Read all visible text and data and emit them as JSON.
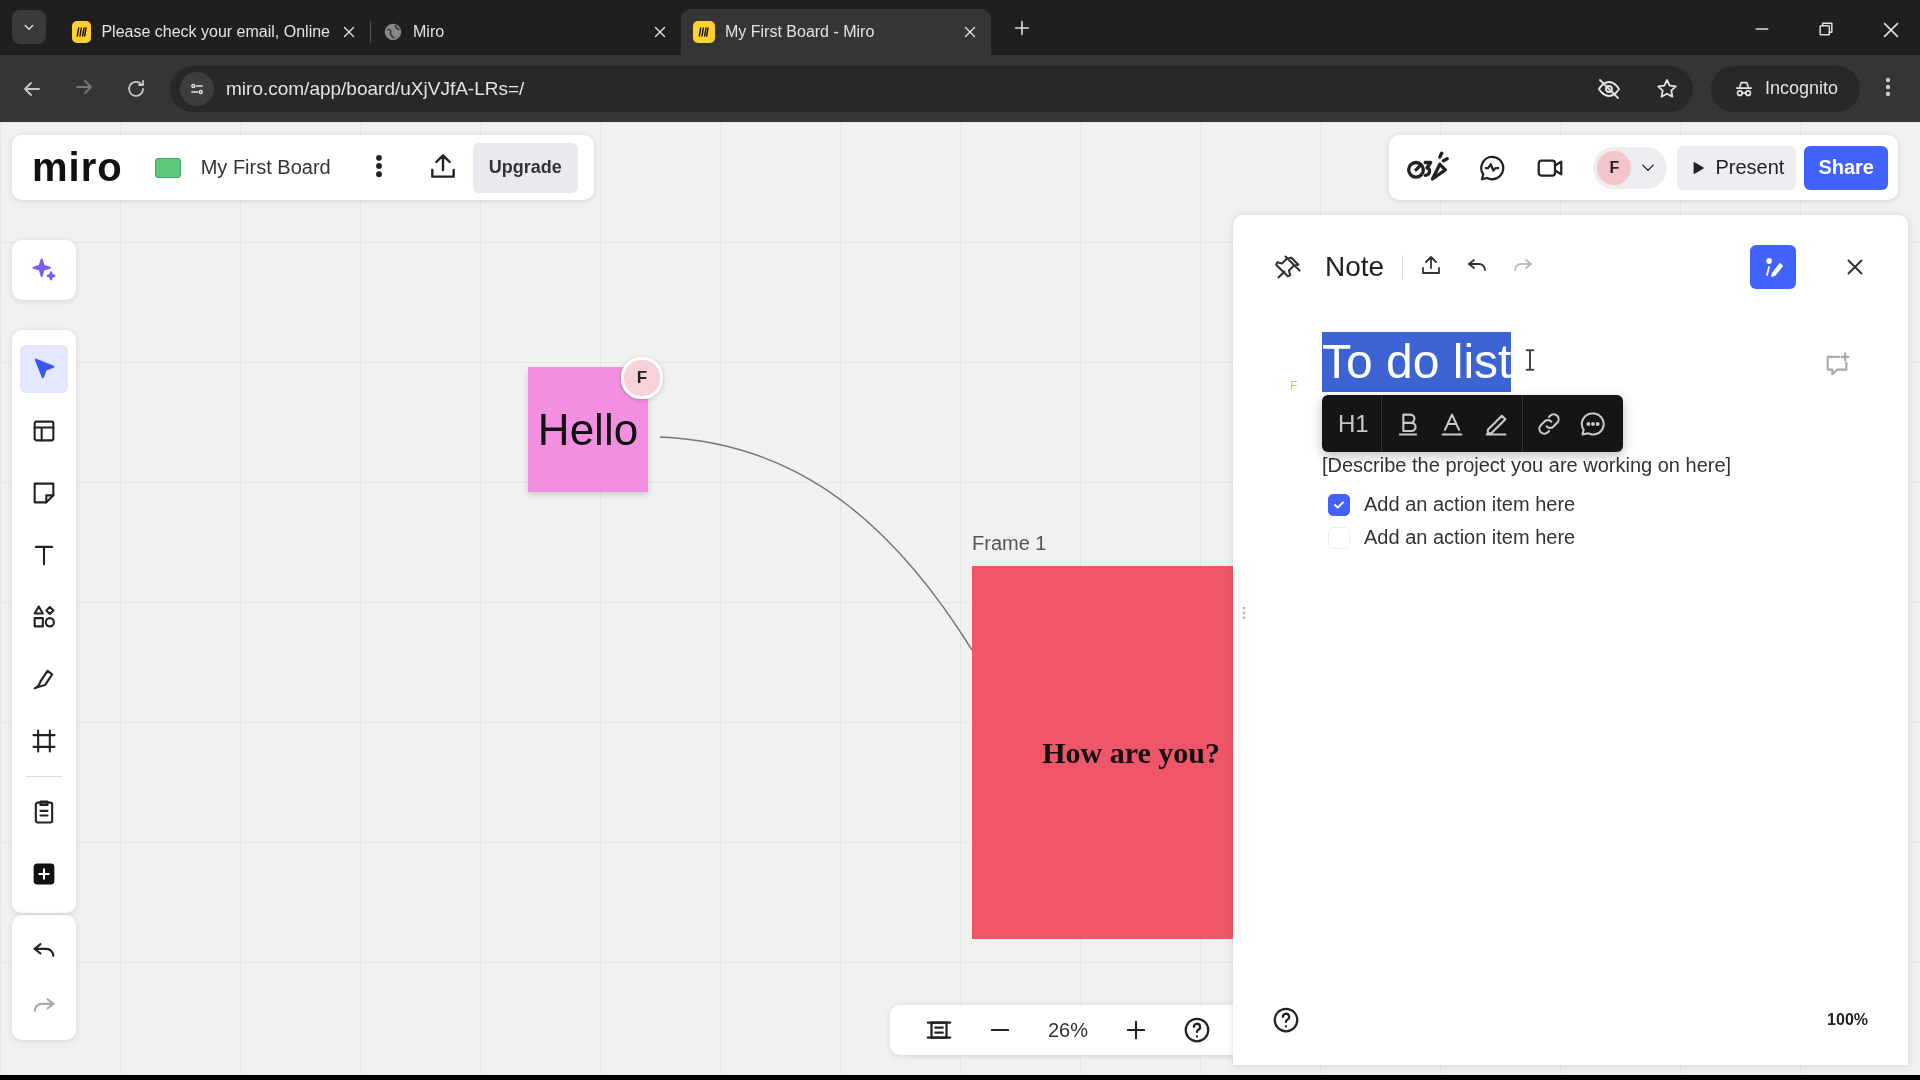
{
  "browser": {
    "tabs": [
      {
        "title": "Please check your email, Online",
        "selected": false
      },
      {
        "title": "Miro",
        "selected": false
      },
      {
        "title": "My First Board - Miro",
        "selected": true
      }
    ],
    "url": "miro.com/app/board/uXjVJfA-LRs=/",
    "profile": "Incognito"
  },
  "board_header": {
    "logo": "miro",
    "board_name": "My First Board",
    "upgrade": "Upgrade"
  },
  "top_bar": {
    "avatar": "F",
    "present": "Present",
    "share": "Share"
  },
  "toolbar": {
    "tools": [
      {
        "kind": "ai",
        "selected": false
      },
      {
        "kind": "select",
        "selected": true
      },
      {
        "kind": "templates",
        "selected": false
      },
      {
        "kind": "sticky",
        "selected": false
      },
      {
        "kind": "text",
        "selected": false
      },
      {
        "kind": "shapes",
        "selected": false
      },
      {
        "kind": "pen",
        "selected": false
      },
      {
        "kind": "frame",
        "selected": false
      },
      {
        "kind": "notes",
        "selected": false
      },
      {
        "kind": "add",
        "selected": false
      },
      {
        "kind": "undo",
        "selected": false
      },
      {
        "kind": "redo",
        "selected": false
      }
    ]
  },
  "canvas": {
    "sticky_note": {
      "text": "Hello",
      "cursor_avatar": "F"
    },
    "frame": {
      "label": "Frame 1",
      "text": "How are you?"
    }
  },
  "zoom_bar": {
    "value": "26%"
  },
  "note_panel": {
    "title": "Note",
    "author_mark": "F",
    "heading": "To do list",
    "format_toolbar": {
      "heading_level": "H1"
    },
    "description": "[Describe the project you are working on here]",
    "action_items": [
      {
        "text": "Add an action item here",
        "checked": true
      },
      {
        "text": "Add an action item here",
        "checked": false
      }
    ],
    "zoom": "100%"
  }
}
